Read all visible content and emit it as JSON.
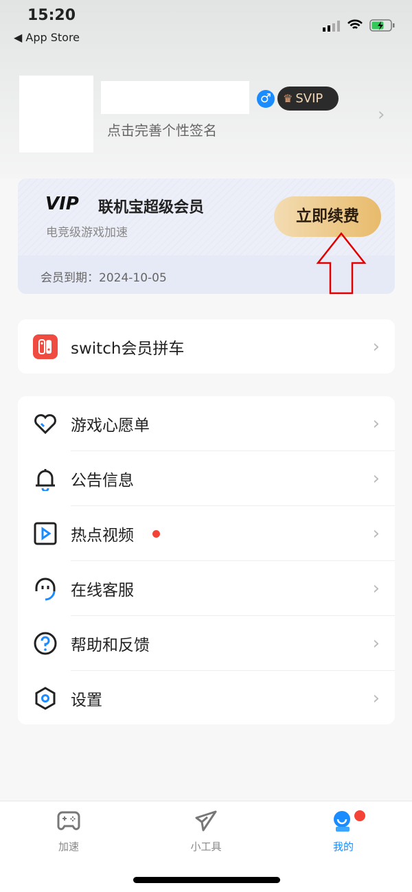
{
  "status_bar": {
    "time": "15:20",
    "back_app": "◀ App Store"
  },
  "profile": {
    "signature_placeholder": "点击完善个性签名",
    "gender_icon": "male-icon",
    "badge": "SVIP"
  },
  "vip_card": {
    "logo": "VIP",
    "title": "联机宝超级会员",
    "subtitle": "电竞级游戏加速",
    "renew_button": "立即续费",
    "expiry_label": "会员到期：",
    "expiry_date": "2024-10-05"
  },
  "switch_item": {
    "label": "switch会员拼车",
    "icon": "nintendo-switch-icon"
  },
  "menu": [
    {
      "label": "游戏心愿单",
      "icon": "heart-icon"
    },
    {
      "label": "公告信息",
      "icon": "bell-icon"
    },
    {
      "label": "热点视频",
      "icon": "video-play-icon",
      "badge_dot": true
    },
    {
      "label": "在线客服",
      "icon": "headset-icon"
    },
    {
      "label": "帮助和反馈",
      "icon": "help-icon"
    },
    {
      "label": "设置",
      "icon": "settings-icon"
    }
  ],
  "tabbar": [
    {
      "label": "加速",
      "icon": "gamepad-icon",
      "active": false
    },
    {
      "label": "小工具",
      "icon": "paper-plane-icon",
      "active": false
    },
    {
      "label": "我的",
      "icon": "profile-icon",
      "active": true
    }
  ],
  "colors": {
    "accent": "#1a8cff",
    "badge_red": "#f44336",
    "gold": "#e9bd6e",
    "annotation_arrow": "#e00000"
  }
}
